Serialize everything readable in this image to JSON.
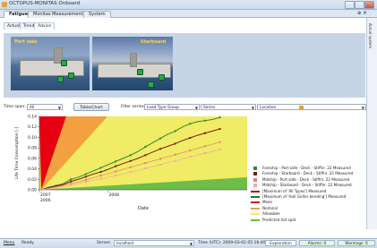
{
  "window": {
    "title": "OCTOPUS-MONITAS Onboard"
  },
  "main_tabs": [
    {
      "label": "Fatigue",
      "active": true
    },
    {
      "label": "Monitas Measurements",
      "active": false
    },
    {
      "label": "System",
      "active": false
    }
  ],
  "sub_tabs": [
    {
      "label": "Actual",
      "active": false
    },
    {
      "label": "Trend",
      "active": false
    },
    {
      "label": "Advice",
      "active": true
    }
  ],
  "side_strip": {
    "label": "Actual system"
  },
  "photos": {
    "port": "Port side",
    "starboard": "Starboard"
  },
  "filters": {
    "time_span_label": "Time span:",
    "time_span_value": "All",
    "table_chart_button": "Table/Chart",
    "filter_series_label": "Filter series:",
    "load_type_group": "Load Type Group",
    "series": "Series",
    "location": "Location"
  },
  "chart_data": {
    "type": "line",
    "ylabel": "Life Time Consumption [-]",
    "xlabel": "Date",
    "yticks": [
      "0.14",
      "0.12",
      "0.10",
      "0.08",
      "0.06",
      "0.04",
      "0.02",
      "0.00"
    ],
    "xticks": [
      "2007",
      "2008"
    ],
    "xsub": "2000",
    "ylim": [
      0,
      0.14
    ],
    "series": [
      {
        "name": "Foreship - Port side - Deck - Stiffnr. 22 Measured",
        "color": "#2a8a2a",
        "values": [
          0.0,
          0.005,
          0.008,
          0.012,
          0.02,
          0.024,
          0.03,
          0.036,
          0.042,
          0.048,
          0.054,
          0.06,
          0.066,
          0.073,
          0.082,
          0.09,
          0.098,
          0.106,
          0.112,
          0.12,
          0.126,
          0.13,
          0.132,
          0.134,
          0.138
        ]
      },
      {
        "name": "Foreship - Starboard - Deck - Stiffnr. 22 Measured",
        "color": "#7a1a1a",
        "values": [
          0.0,
          0.004,
          0.007,
          0.01,
          0.016,
          0.02,
          0.025,
          0.03,
          0.034,
          0.039,
          0.045,
          0.05,
          0.055,
          0.06,
          0.066,
          0.072,
          0.078,
          0.083,
          0.088,
          0.094,
          0.099,
          0.104,
          0.108,
          0.112,
          0.116
        ]
      },
      {
        "name": "Midship - Port side - Deck - Stiffnr. 22 Measured",
        "color": "#e07f7f",
        "values": [
          0.0,
          0.003,
          0.005,
          0.008,
          0.012,
          0.015,
          0.019,
          0.023,
          0.027,
          0.031,
          0.035,
          0.039,
          0.043,
          0.047,
          0.051,
          0.055,
          0.059,
          0.063,
          0.067,
          0.071,
          0.075,
          0.079,
          0.083,
          0.087,
          0.091
        ]
      },
      {
        "name": "Midship - Starboard - Deck - Stiffnr. 22 Measured",
        "color": "#f2a8a8",
        "values": [
          0.0,
          0.002,
          0.004,
          0.006,
          0.009,
          0.012,
          0.015,
          0.018,
          0.021,
          0.024,
          0.027,
          0.03,
          0.034,
          0.037,
          0.041,
          0.044,
          0.048,
          0.052,
          0.055,
          0.059,
          0.063,
          0.066,
          0.07,
          0.073,
          0.077
        ]
      }
    ],
    "legend": [
      {
        "label": "Foreship - Port side - Deck - Stiffnr. 22 Measured",
        "color": "#2a8a2a",
        "marker": "star"
      },
      {
        "label": "Foreship - Starboard - Deck - Stiffnr. 22 Measured",
        "color": "#7a1a1a",
        "marker": "square"
      },
      {
        "label": "Midship - Port side - Deck - Stiffnr. 22 Measured",
        "color": "#e07f7f",
        "marker": "diamond"
      },
      {
        "label": "Midship - Starboard - Deck - Stiffnr. 22 Measured",
        "color": "#f2a8a8",
        "marker": "triangle"
      },
      {
        "label": "[Maximum of 'All Types'] Measured",
        "color": "#b3001a",
        "marker": "line"
      },
      {
        "label": "[Maximum of 'Hull Girder bending'] Measured",
        "color": "#1a7a1a",
        "marker": "line"
      },
      {
        "label": "Mean",
        "color": "#d11a1a",
        "marker": "line"
      },
      {
        "label": "Nominal",
        "color": "#f2a040",
        "marker": "line"
      },
      {
        "label": "Allowable",
        "color": "#f5ec5a",
        "marker": "line"
      },
      {
        "label": "Predicted hot spot",
        "color": "#62c24a",
        "marker": "line"
      }
    ]
  },
  "status_bar": {
    "menu": "Menu",
    "ready": "Ready",
    "server_label": "Server:",
    "server_value": "localhost",
    "time": "Time (UTC): 2009-03-02 05:16:40",
    "exploration": "Exploration",
    "alarms": "Alarms: 0",
    "warnings": "Warnings: 0"
  }
}
